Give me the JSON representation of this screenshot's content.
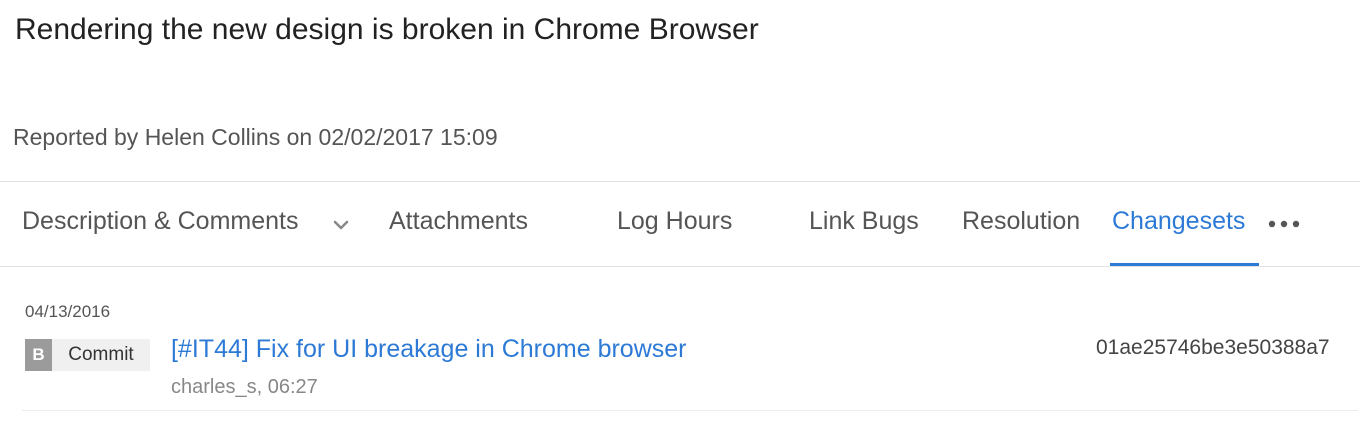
{
  "issue": {
    "title": "Rendering the new design is broken in Chrome Browser",
    "reported": "Reported by Helen Collins on 02/02/2017 15:09"
  },
  "tabs": [
    {
      "label": "Description & Comments",
      "has_dropdown": true,
      "active": false
    },
    {
      "label": "Attachments",
      "active": false
    },
    {
      "label": "Log Hours",
      "active": false
    },
    {
      "label": "Link Bugs",
      "active": false
    },
    {
      "label": "Resolution",
      "active": false
    },
    {
      "label": "Changesets",
      "active": true
    }
  ],
  "more_menu": {
    "icon": "more-horizontal-icon"
  },
  "changesets": [
    {
      "date": "04/13/2016",
      "badge_letter": "B",
      "type": "Commit",
      "message": "[#IT44] Fix for UI breakage in Chrome browser",
      "meta": "charles_s, 06:27",
      "hash": "01ae25746be3e50388a7"
    }
  ],
  "colors": {
    "accent": "#2d7ad6",
    "text": "#333333",
    "muted": "#888888",
    "badge_letter_bg": "#9b9b9b",
    "badge_bg": "#f0f0f0"
  }
}
